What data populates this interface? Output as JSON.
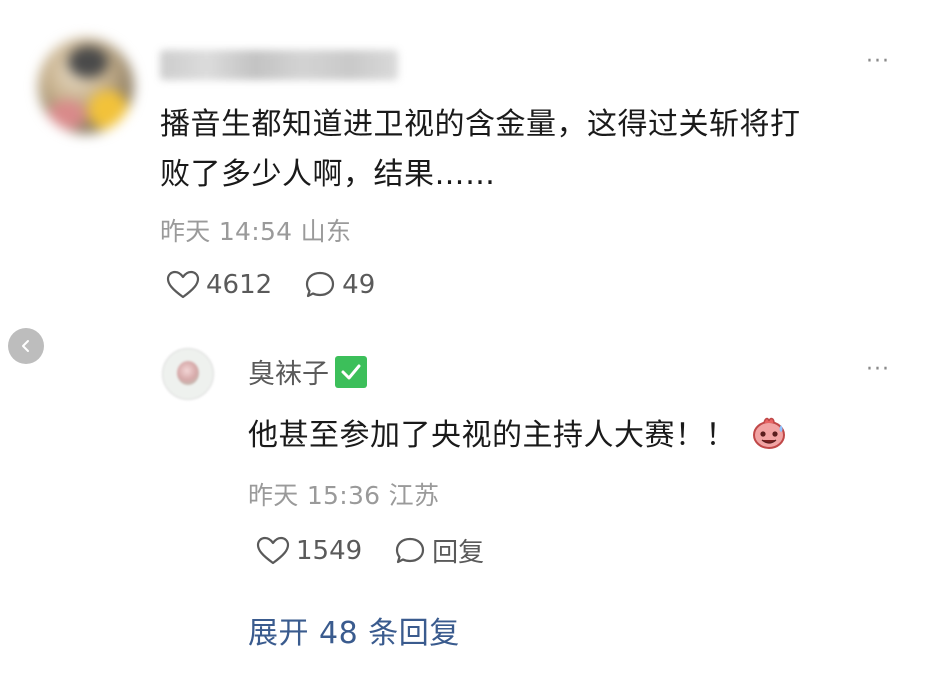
{
  "comment": {
    "author_name": "",
    "text_line1": "播音生都知道进卫视的含金量，这得过关斩将打",
    "text_line2": "败了多少人啊，结果……",
    "time": "昨天 14:54",
    "location": "山东",
    "likes": "4612",
    "replies": "49",
    "more_label": "···"
  },
  "reply": {
    "author_name": "臭袜子",
    "text": "他甚至参加了央视的主持人大赛！！",
    "time": "昨天 15:36",
    "location": "江苏",
    "likes": "1549",
    "reply_label": "回复",
    "more_label": "···"
  },
  "expand": {
    "label": "展开 48 条回复"
  },
  "colors": {
    "link": "#3a5b8e",
    "meta": "#9a9a9a",
    "verified": "#3cbf5a"
  },
  "icons": {
    "like": "heart-icon",
    "comment": "speech-bubble-icon",
    "back": "chevron-left-icon",
    "verified": "checkmark-icon",
    "more": "ellipsis-icon",
    "emoji": "sweat-smile-emoji-icon"
  }
}
